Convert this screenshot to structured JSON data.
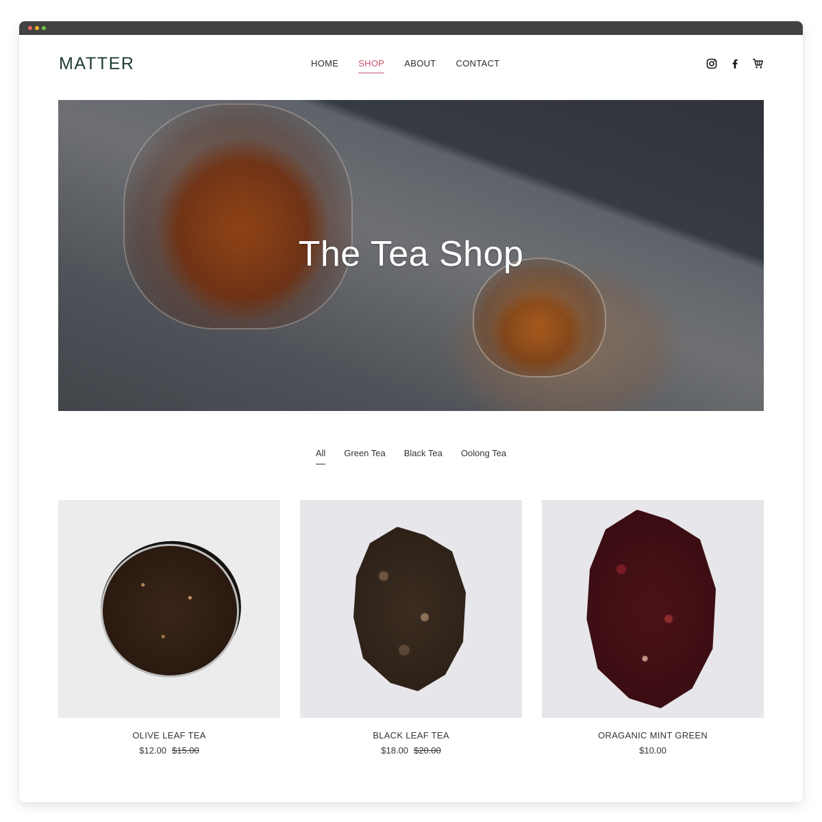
{
  "window": {
    "controls": [
      "close",
      "minimize",
      "maximize"
    ]
  },
  "header": {
    "logo": "MATTER",
    "nav": [
      {
        "label": "HOME",
        "active": false
      },
      {
        "label": "SHOP",
        "active": true
      },
      {
        "label": "ABOUT",
        "active": false
      },
      {
        "label": "CONTACT",
        "active": false
      }
    ],
    "accent_color": "#c4536b",
    "icons": [
      "instagram-icon",
      "facebook-icon",
      "cart-icon"
    ]
  },
  "hero": {
    "title": "The Tea Shop"
  },
  "filters": [
    {
      "label": "All",
      "active": true
    },
    {
      "label": "Green Tea",
      "active": false
    },
    {
      "label": "Black Tea",
      "active": false
    },
    {
      "label": "Oolong Tea",
      "active": false
    }
  ],
  "products": [
    {
      "name": "OLIVE LEAF TEA",
      "price": "$12.00",
      "old_price": "$15.00"
    },
    {
      "name": "BLACK LEAF TEA",
      "price": "$18.00",
      "old_price": "$20.00"
    },
    {
      "name": "ORAGANIC MINT GREEN",
      "price": "$10.00",
      "old_price": null
    }
  ]
}
